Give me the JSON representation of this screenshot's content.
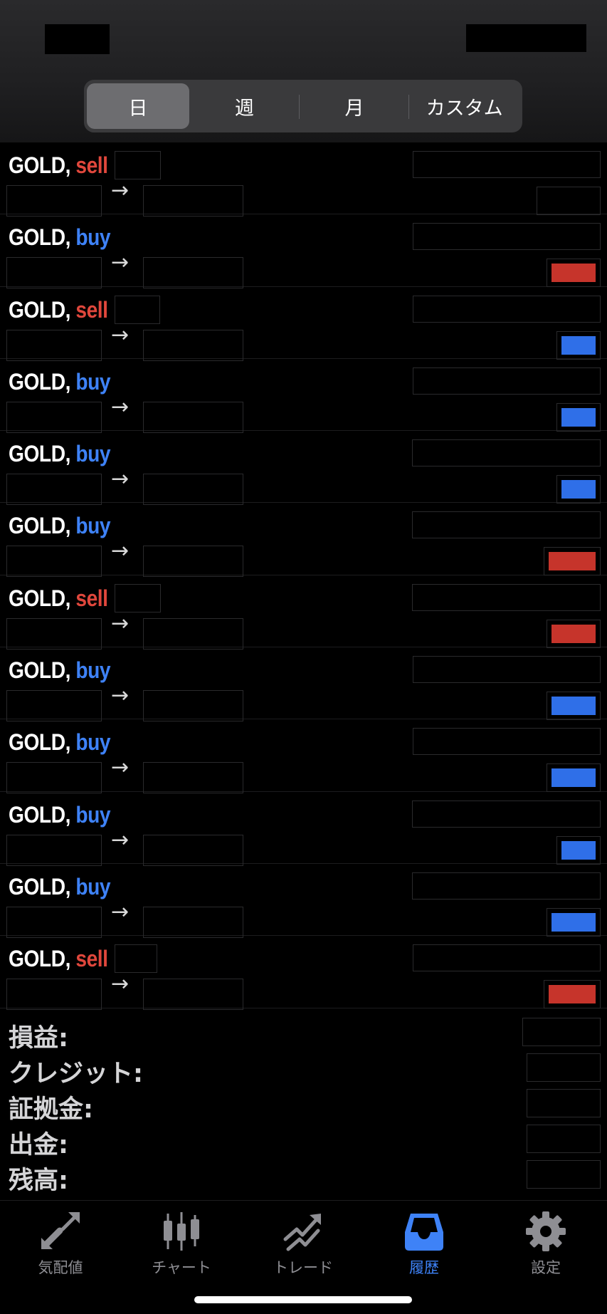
{
  "header": {
    "segments": [
      "日",
      "週",
      "月",
      "カスタム"
    ],
    "active_segment": 0
  },
  "trades": [
    {
      "symbol": "GOLD,",
      "side": "sell",
      "result": "loss"
    },
    {
      "symbol": "GOLD,",
      "side": "buy",
      "result": "loss"
    },
    {
      "symbol": "GOLD,",
      "side": "sell",
      "result": "profit"
    },
    {
      "symbol": "GOLD,",
      "side": "buy",
      "result": "profit"
    },
    {
      "symbol": "GOLD,",
      "side": "buy",
      "result": "profit"
    },
    {
      "symbol": "GOLD,",
      "side": "buy",
      "result": "loss"
    },
    {
      "symbol": "GOLD,",
      "side": "sell",
      "result": "loss"
    },
    {
      "symbol": "GOLD,",
      "side": "buy",
      "result": "profit"
    },
    {
      "symbol": "GOLD,",
      "side": "buy",
      "result": "profit"
    },
    {
      "symbol": "GOLD,",
      "side": "buy",
      "result": "profit"
    },
    {
      "symbol": "GOLD,",
      "side": "buy",
      "result": "profit"
    },
    {
      "symbol": "GOLD,",
      "side": "sell",
      "result": "loss"
    }
  ],
  "arrow": "→",
  "summary": {
    "profit_label": "損益:",
    "credit_label": "クレジット:",
    "margin_label": "証拠金:",
    "withdraw_label": "出金:",
    "balance_label": "残高:"
  },
  "tabs": [
    {
      "label": "気配値",
      "icon": "quotes-arrows-icon"
    },
    {
      "label": "チャート",
      "icon": "candlestick-chart-icon"
    },
    {
      "label": "トレード",
      "icon": "trade-trend-icon"
    },
    {
      "label": "履歴",
      "icon": "history-inbox-icon"
    },
    {
      "label": "設定",
      "icon": "gear-icon"
    }
  ],
  "active_tab": 3,
  "colors": {
    "sell": "#e0473c",
    "buy": "#3e82f7",
    "profit_fill": "#2f6fe8",
    "loss_fill": "#c6342b",
    "accent": "#3e82f7"
  }
}
